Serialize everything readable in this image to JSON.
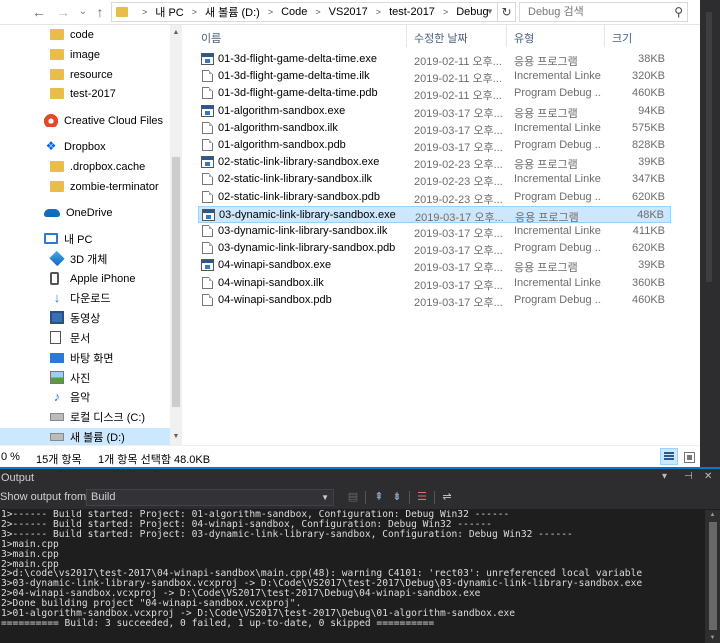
{
  "explorer": {
    "nav_buttons": {
      "back": "←",
      "forward": "→",
      "recent": "⌄",
      "up": "↑"
    },
    "breadcrumbs": [
      "내 PC",
      "새 볼륨 (D:)",
      "Code",
      "VS2017",
      "test-2017",
      "Debug"
    ],
    "search_placeholder": "Debug 검색",
    "nav_items": [
      {
        "label": "code",
        "icon": "folder-icon"
      },
      {
        "label": "image",
        "icon": "folder-icon"
      },
      {
        "label": "resource",
        "icon": "folder-icon"
      },
      {
        "label": "test-2017",
        "icon": "folder-icon"
      },
      {
        "label": "Creative Cloud Files",
        "icon": "creative-cloud-icon"
      },
      {
        "label": "Dropbox",
        "icon": "dropbox-icon"
      },
      {
        "label": ".dropbox.cache",
        "icon": "folder-icon"
      },
      {
        "label": "zombie-terminator",
        "icon": "folder-icon"
      },
      {
        "label": "OneDrive",
        "icon": "onedrive-icon"
      },
      {
        "label": "내 PC",
        "icon": "pc-icon"
      },
      {
        "label": "3D 개체",
        "icon": "3d-objects-icon"
      },
      {
        "label": "Apple iPhone",
        "icon": "phone-icon"
      },
      {
        "label": "다운로드",
        "icon": "download-icon"
      },
      {
        "label": "동영상",
        "icon": "video-icon"
      },
      {
        "label": "문서",
        "icon": "document-icon"
      },
      {
        "label": "바탕 화면",
        "icon": "desktop-icon"
      },
      {
        "label": "사진",
        "icon": "photo-icon"
      },
      {
        "label": "음악",
        "icon": "music-icon"
      },
      {
        "label": "로컬 디스크 (C:)",
        "icon": "drive-icon"
      },
      {
        "label": "새 볼륨 (D:)",
        "icon": "drive-icon"
      }
    ],
    "columns": {
      "name": "이름",
      "date": "수정한 날짜",
      "type": "유형",
      "size": "크기"
    },
    "files": [
      {
        "name": "01-3d-flight-game-delta-time.exe",
        "date": "2019-02-11 오후...",
        "type": "응용 프로그램",
        "size": "38KB",
        "kind": "exe"
      },
      {
        "name": "01-3d-flight-game-delta-time.ilk",
        "date": "2019-02-11 오후...",
        "type": "Incremental Linke...",
        "size": "320KB",
        "kind": "ilk"
      },
      {
        "name": "01-3d-flight-game-delta-time.pdb",
        "date": "2019-02-11 오후...",
        "type": "Program Debug ...",
        "size": "460KB",
        "kind": "pdb"
      },
      {
        "name": "01-algorithm-sandbox.exe",
        "date": "2019-03-17 오후...",
        "type": "응용 프로그램",
        "size": "94KB",
        "kind": "exe"
      },
      {
        "name": "01-algorithm-sandbox.ilk",
        "date": "2019-03-17 오후...",
        "type": "Incremental Linke...",
        "size": "575KB",
        "kind": "ilk"
      },
      {
        "name": "01-algorithm-sandbox.pdb",
        "date": "2019-03-17 오후...",
        "type": "Program Debug ...",
        "size": "828KB",
        "kind": "pdb"
      },
      {
        "name": "02-static-link-library-sandbox.exe",
        "date": "2019-02-23 오후...",
        "type": "응용 프로그램",
        "size": "39KB",
        "kind": "exe"
      },
      {
        "name": "02-static-link-library-sandbox.ilk",
        "date": "2019-02-23 오후...",
        "type": "Incremental Linke...",
        "size": "347KB",
        "kind": "ilk"
      },
      {
        "name": "02-static-link-library-sandbox.pdb",
        "date": "2019-02-23 오후...",
        "type": "Program Debug ...",
        "size": "620KB",
        "kind": "pdb"
      },
      {
        "name": "03-dynamic-link-library-sandbox.exe",
        "date": "2019-03-17 오후...",
        "type": "응용 프로그램",
        "size": "48KB",
        "kind": "exe",
        "selected": true
      },
      {
        "name": "03-dynamic-link-library-sandbox.ilk",
        "date": "2019-03-17 오후...",
        "type": "Incremental Linke...",
        "size": "411KB",
        "kind": "ilk"
      },
      {
        "name": "03-dynamic-link-library-sandbox.pdb",
        "date": "2019-03-17 오후...",
        "type": "Program Debug ...",
        "size": "620KB",
        "kind": "pdb"
      },
      {
        "name": "04-winapi-sandbox.exe",
        "date": "2019-03-17 오후...",
        "type": "응용 프로그램",
        "size": "39KB",
        "kind": "exe"
      },
      {
        "name": "04-winapi-sandbox.ilk",
        "date": "2019-03-17 오후...",
        "type": "Incremental Linke...",
        "size": "360KB",
        "kind": "ilk"
      },
      {
        "name": "04-winapi-sandbox.pdb",
        "date": "2019-03-17 오후...",
        "type": "Program Debug ...",
        "size": "460KB",
        "kind": "pdb"
      }
    ],
    "status": {
      "left_fragment": "0 %",
      "items_count": "15개 항목",
      "selection": "1개 항목 선택함 48.0KB"
    }
  },
  "output": {
    "title": "Output",
    "show_from_label": "Show output from:",
    "source": "Build",
    "lines": [
      "1>------ Build started: Project: 01-algorithm-sandbox, Configuration: Debug Win32 ------",
      "2>------ Build started: Project: 04-winapi-sandbox, Configuration: Debug Win32 ------",
      "3>------ Build started: Project: 03-dynamic-link-library-sandbox, Configuration: Debug Win32 ------",
      "1>main.cpp",
      "3>main.cpp",
      "2>main.cpp",
      "2>d:\\code\\vs2017\\test-2017\\04-winapi-sandbox\\main.cpp(48): warning C4101: 'rect03': unreferenced local variable",
      "3>03-dynamic-link-library-sandbox.vcxproj -> D:\\Code\\VS2017\\test-2017\\Debug\\03-dynamic-link-library-sandbox.exe",
      "2>04-winapi-sandbox.vcxproj -> D:\\Code\\VS2017\\test-2017\\Debug\\04-winapi-sandbox.exe",
      "2>Done building project \"04-winapi-sandbox.vcxproj\".",
      "1>01-algorithm-sandbox.vcxproj -> D:\\Code\\VS2017\\test-2017\\Debug\\01-algorithm-sandbox.exe",
      "========== Build: 3 succeeded, 0 failed, 1 up-to-date, 0 skipped =========="
    ]
  }
}
